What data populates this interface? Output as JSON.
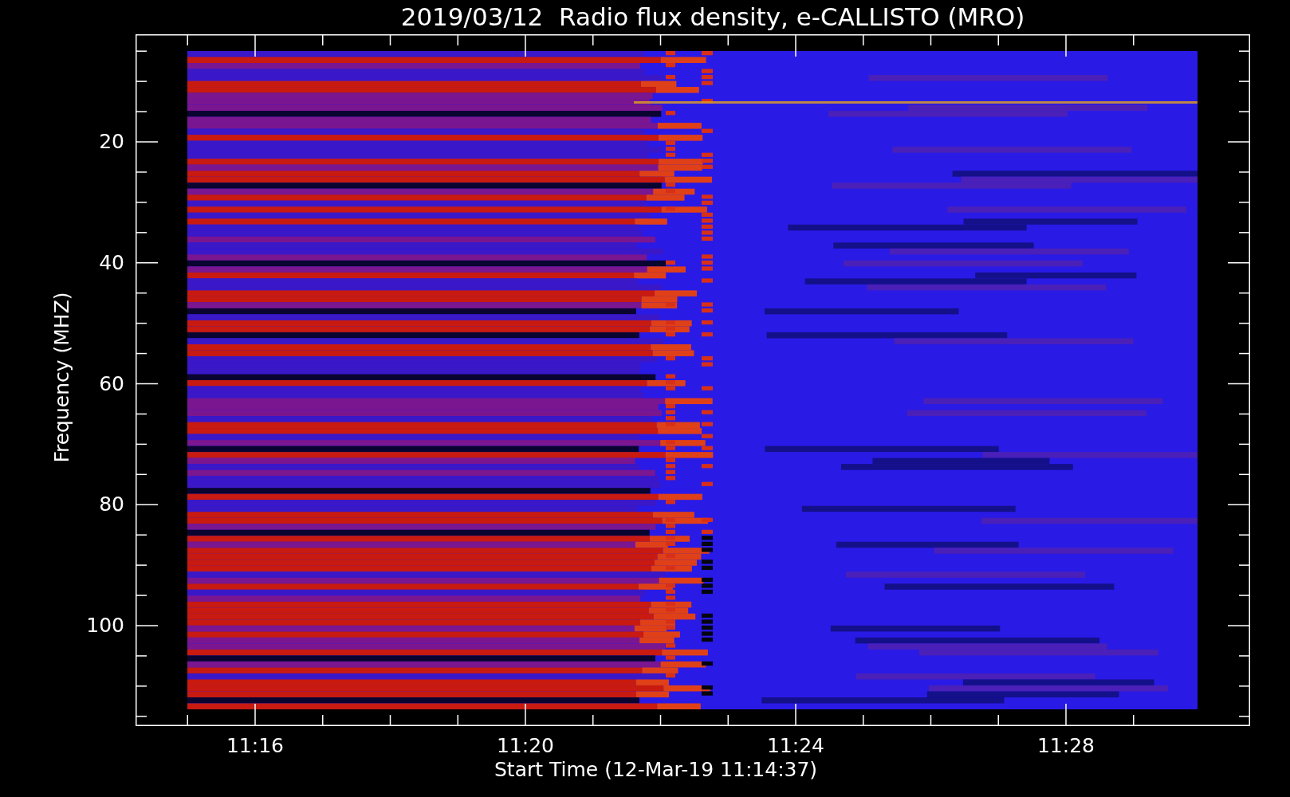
{
  "title": "2019/03/12  Radio flux density, e-CALLISTO (MRO)",
  "y_axis": {
    "label": "Frequency (MHZ)",
    "ticks": [
      "20",
      "40",
      "60",
      "80",
      "100"
    ]
  },
  "x_axis": {
    "label": "Start Time (12-Mar-19 11:14:37)",
    "ticks": [
      "11:16",
      "11:20",
      "11:24",
      "11:28"
    ]
  }
}
